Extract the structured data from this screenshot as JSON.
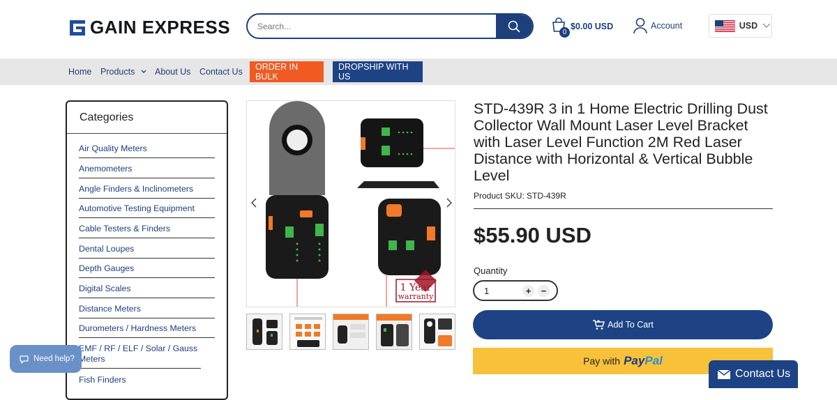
{
  "brand": {
    "name": "GAIN EXPRESS",
    "color": "#1f4ea0"
  },
  "search": {
    "placeholder": "Search..."
  },
  "cart": {
    "count": "0",
    "total": "$0.00 USD"
  },
  "account": {
    "label": "Account"
  },
  "currency": {
    "code": "USD"
  },
  "nav": {
    "items": [
      "Home",
      "Products",
      "About Us",
      "Contact Us"
    ],
    "order_bulk": "ORDER IN BULK",
    "dropship": "DROPSHIP WITH US",
    "order_bulk_color": "#f15a22",
    "dropship_color": "#1d4385"
  },
  "sidebar": {
    "title": "Categories",
    "categories": [
      "Air Quality Meters",
      "Anemometers",
      "Angle Finders & Inclinometers",
      "Automotive Testing Equipment",
      "Cable Testers & Finders",
      "Dental Loupes",
      "Depth Gauges",
      "Digital Scales",
      "Distance Meters",
      "Durometers / Hardness Meters",
      "EMF / RF / ELF / Solar / Gauss Meters",
      "Fish Finders"
    ]
  },
  "gallery": {
    "warranty_line1": "1 Year",
    "warranty_line2": "warranty",
    "thumbnail_count": 6
  },
  "product": {
    "title": "STD-439R 3 in 1 Home Electric Drilling Dust Collector Wall Mount Laser Level Bracket with Laser Level Function 2M Red Laser Distance with Horizontal & Vertical Bubble Level",
    "sku_label": "Product SKU:",
    "sku": "STD-439R",
    "price": "$55.90 USD",
    "quantity_label": "Quantity",
    "quantity": "1",
    "plus": "+",
    "minus": "−",
    "add_to_cart": "Add To Cart",
    "paypal_prefix": "Pay with",
    "paypal_brand_1": "Pay",
    "paypal_brand_2": "Pal"
  },
  "widgets": {
    "need_help": "Need help?",
    "contact_us": "Contact Us"
  }
}
